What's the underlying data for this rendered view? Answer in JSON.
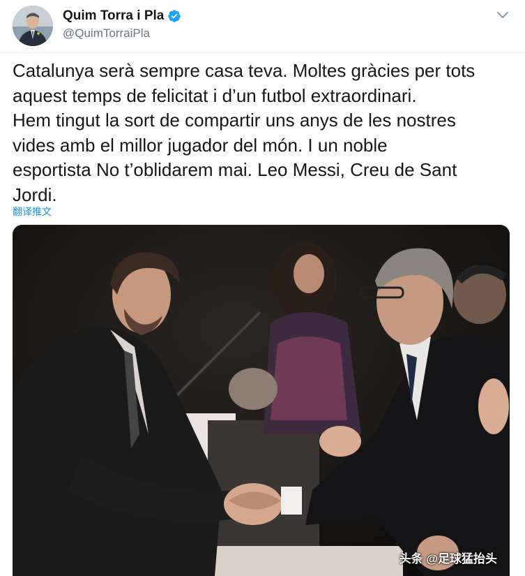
{
  "tweet": {
    "author_name": "Quim Torra i Pla",
    "author_handle": "@QuimTorraiPla",
    "text": "Catalunya serà sempre casa teva. Moltes gràcies per tots\naquest temps de felicitat i d’un futbol extraordinari.\nHem tingut la sort de compartir uns anys de les nostres\nvides amb el millor jugador del món. I un noble\nesportista No t’oblidarem mai. Leo Messi, Creu de Sant\nJordi.",
    "translate_label": "翻译推文"
  },
  "media": {
    "watermark": "头条 @足球猛抬头"
  },
  "icons": {
    "verified": "verified-badge-icon",
    "menu": "chevron-down-icon"
  },
  "colors": {
    "verified_blue": "#1da1f2",
    "link_blue": "#1b95e0",
    "text": "#14171a",
    "secondary": "#657786"
  }
}
